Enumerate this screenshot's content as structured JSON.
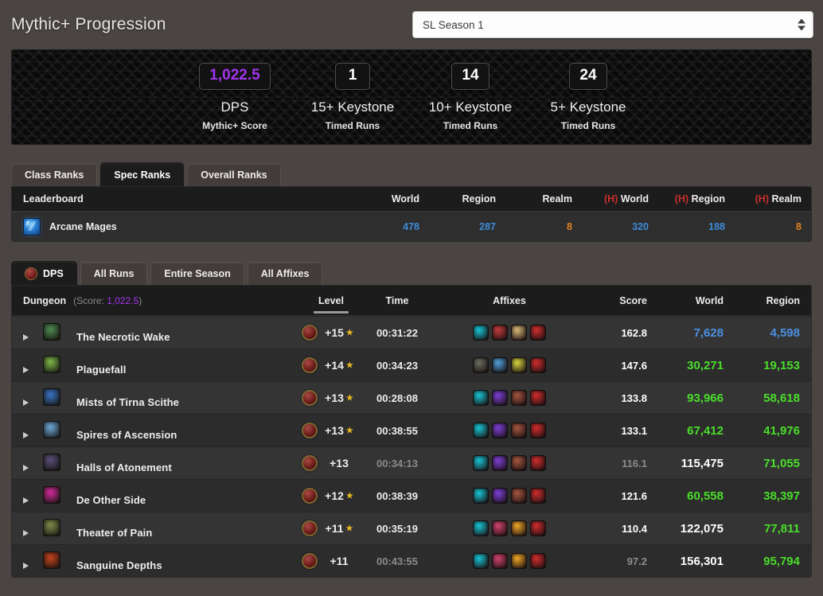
{
  "header": {
    "title": "Mythic+ Progression",
    "season_select": {
      "value": "SL Season 1",
      "name": "season-select"
    }
  },
  "banner": {
    "stats": [
      {
        "value": "1,022.5",
        "label": "DPS",
        "sub": "Mythic+ Score",
        "color": "#a335ee"
      },
      {
        "value": "1",
        "label": "15+ Keystone",
        "sub": "Timed Runs",
        "color": "#ffffff"
      },
      {
        "value": "14",
        "label": "10+ Keystone",
        "sub": "Timed Runs",
        "color": "#ffffff"
      },
      {
        "value": "24",
        "label": "5+ Keystone",
        "sub": "Timed Runs",
        "color": "#ffffff"
      }
    ]
  },
  "rank_tabs": [
    {
      "label": "Class Ranks",
      "active": false
    },
    {
      "label": "Spec Ranks",
      "active": true
    },
    {
      "label": "Overall Ranks",
      "active": false
    }
  ],
  "leaderboard": {
    "headers": {
      "name": "Leaderboard",
      "world": "World",
      "region": "Region",
      "realm": "Realm",
      "h_prefix": "(H)",
      "h_world": "World",
      "h_region": "Region",
      "h_realm": "Realm"
    },
    "rows": [
      {
        "spec": "Arcane Mages",
        "world": "478",
        "region": "287",
        "realm": "8",
        "h_world": "320",
        "h_region": "188",
        "h_realm": "8"
      }
    ]
  },
  "run_tabs": [
    {
      "label": "DPS",
      "active": true,
      "icon": "dps-role-icon"
    },
    {
      "label": "All Runs",
      "active": false
    },
    {
      "label": "Entire Season",
      "active": false
    },
    {
      "label": "All Affixes",
      "active": false
    }
  ],
  "runs_table": {
    "headers": {
      "dungeon": "Dungeon",
      "score_note_prefix": "(Score:",
      "score_note_value": "1,022.5",
      "score_note_suffix": ")",
      "level": "Level",
      "time": "Time",
      "affixes": "Affixes",
      "score": "Score",
      "world": "World",
      "region": "Region"
    },
    "sorted_column": "Level",
    "rows": [
      {
        "dungeon": "The Necrotic Wake",
        "icon_color": "#4f8a52",
        "level": "+15",
        "timed": true,
        "time": "00:31:22",
        "in_time": true,
        "affixes": [
          "#17c4d4",
          "#c23b3b",
          "#d8b878",
          "#cf2d2d"
        ],
        "score": "162.8",
        "score_dim": false,
        "world": "7,628",
        "world_color": "blue",
        "region": "4,598",
        "region_color": "blue"
      },
      {
        "dungeon": "Plaguefall",
        "icon_color": "#7db54a",
        "level": "+14",
        "timed": true,
        "time": "00:34:23",
        "in_time": true,
        "affixes": [
          "#6b6f62",
          "#4f9fd8",
          "#d6d23f",
          "#cf2d2d"
        ],
        "score": "147.6",
        "score_dim": false,
        "world": "30,271",
        "world_color": "green",
        "region": "19,153",
        "region_color": "green"
      },
      {
        "dungeon": "Mists of Tirna Scithe",
        "icon_color": "#3a72c4",
        "level": "+13",
        "timed": true,
        "time": "00:28:08",
        "in_time": true,
        "affixes": [
          "#17c4d4",
          "#7b3fd4",
          "#a5563f",
          "#cf2d2d"
        ],
        "score": "133.8",
        "score_dim": false,
        "world": "93,966",
        "world_color": "green",
        "region": "58,618",
        "region_color": "green"
      },
      {
        "dungeon": "Spires of Ascension",
        "icon_color": "#6ea7d8",
        "level": "+13",
        "timed": true,
        "time": "00:38:55",
        "in_time": true,
        "affixes": [
          "#17c4d4",
          "#7b3fd4",
          "#a5563f",
          "#cf2d2d"
        ],
        "score": "133.1",
        "score_dim": false,
        "world": "67,412",
        "world_color": "green",
        "region": "41,976",
        "region_color": "green"
      },
      {
        "dungeon": "Halls of Atonement",
        "icon_color": "#5a4f7a",
        "level": "+13",
        "timed": false,
        "time": "00:34:13",
        "in_time": false,
        "affixes": [
          "#17c4d4",
          "#7b3fd4",
          "#a5563f",
          "#cf2d2d"
        ],
        "score": "116.1",
        "score_dim": true,
        "world": "115,475",
        "world_color": "white",
        "region": "71,055",
        "region_color": "green"
      },
      {
        "dungeon": "De Other Side",
        "icon_color": "#d02a9a",
        "level": "+12",
        "timed": true,
        "time": "00:38:39",
        "in_time": true,
        "affixes": [
          "#17c4d4",
          "#7b3fd4",
          "#a5563f",
          "#cf2d2d"
        ],
        "score": "121.6",
        "score_dim": false,
        "world": "60,558",
        "world_color": "green",
        "region": "38,397",
        "region_color": "green"
      },
      {
        "dungeon": "Theater of Pain",
        "icon_color": "#7f8a4a",
        "level": "+11",
        "timed": true,
        "time": "00:35:19",
        "in_time": true,
        "affixes": [
          "#17c4d4",
          "#d0436d",
          "#f0a526",
          "#cf2d2d"
        ],
        "score": "110.4",
        "score_dim": false,
        "world": "122,075",
        "world_color": "white",
        "region": "77,811",
        "region_color": "green"
      },
      {
        "dungeon": "Sanguine Depths",
        "icon_color": "#c4421e",
        "level": "+11",
        "timed": false,
        "time": "00:43:55",
        "in_time": false,
        "affixes": [
          "#17c4d4",
          "#d0436d",
          "#f0a526",
          "#cf2d2d"
        ],
        "score": "97.2",
        "score_dim": true,
        "world": "156,301",
        "world_color": "white",
        "region": "95,794",
        "region_color": "green"
      }
    ]
  }
}
